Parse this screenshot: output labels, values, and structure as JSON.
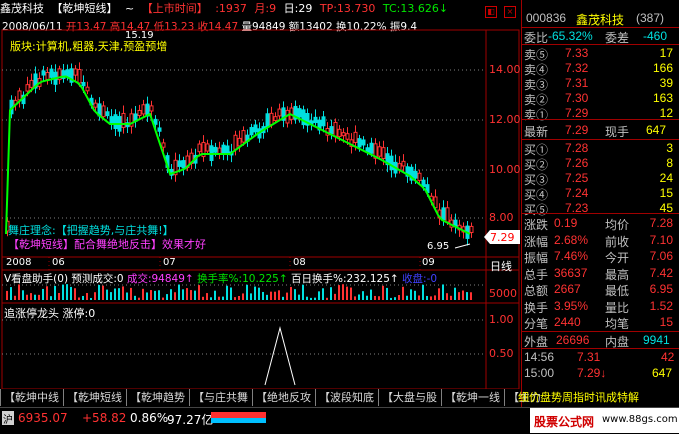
{
  "colors": {
    "up": "#ff3232",
    "down": "#00e0e0",
    "ma": "#00ff00",
    "frame": "#a00000",
    "label": "#ffff00",
    "peach": "#ffa0a0"
  },
  "header": {
    "stock_name": "鑫茂科技",
    "indicator": "【乾坤短线】",
    "tilde": "~",
    "ipo_time": "【上市时间】",
    "ipo_value": ":1937",
    "month": "月:9",
    "day": "日:29",
    "tp": "TP:13.730",
    "tc": "TC:13.626↓"
  },
  "quote_line": {
    "date": "2008/06/11",
    "open": "开13.47",
    "high": "高14.47",
    "low": "低13.23",
    "close": "收14.47",
    "volume": "量94849",
    "amount": "额13402",
    "turnover": "换10.22%",
    "amplitude": "振9.4"
  },
  "sector_label": "版块:计算机,粗器,天津,预盈预增",
  "high_marker": "15.19",
  "low_marker": "6.95",
  "price_axis": [
    "14.00",
    "12.00",
    "10.00",
    "8.00"
  ],
  "current_price_tag": "7.29",
  "philosophy": "舞庄理念:【把握趋势,与庄共舞!】",
  "combo_text": "【乾坤短线】配合舞绝地反击】效果才好",
  "date_axis": [
    "2008",
    "06",
    "07",
    "08",
    "09"
  ],
  "period_button": "日线",
  "volume_header": {
    "title": "V看盘助手(0) 预测成交:0",
    "vol": "成交:94849↑",
    "turnover": "换手率%:10.225↑",
    "hundred": "百日换手%:232.125↑",
    "close_label": "收盘:-0"
  },
  "vol_axis": "5000",
  "limit_up_title": "追涨停龙头 涨停:0",
  "limit_axis": [
    "1.00",
    "0.50"
  ],
  "right_panel": {
    "code": "000836",
    "name": "鑫茂科技",
    "suffix": "(387)",
    "wei_bi_label": "委比",
    "wei_bi": "-65.32%",
    "wei_cha_label": "委差",
    "wei_cha": "-460",
    "asks": [
      {
        "label": "卖⑤",
        "price": "7.33",
        "vol": "17"
      },
      {
        "label": "卖④",
        "price": "7.32",
        "vol": "166"
      },
      {
        "label": "卖③",
        "price": "7.31",
        "vol": "39"
      },
      {
        "label": "卖②",
        "price": "7.30",
        "vol": "163"
      },
      {
        "label": "卖①",
        "price": "7.29",
        "vol": "12"
      }
    ],
    "latest_label": "最新",
    "latest": "7.29",
    "now_vol_label": "现手",
    "now_vol": "647",
    "bids": [
      {
        "label": "买①",
        "price": "7.28",
        "vol": "3"
      },
      {
        "label": "买②",
        "price": "7.26",
        "vol": "8"
      },
      {
        "label": "买③",
        "price": "7.25",
        "vol": "24"
      },
      {
        "label": "买④",
        "price": "7.24",
        "vol": "15"
      },
      {
        "label": "买⑤",
        "price": "7.23",
        "vol": "45"
      }
    ],
    "stats": [
      {
        "l1": "涨跌",
        "v1": "0.19",
        "l2": "均价",
        "v2": "7.28"
      },
      {
        "l1": "涨幅",
        "v1": "2.68%",
        "l2": "前收",
        "v2": "7.10"
      },
      {
        "l1": "振幅",
        "v1": "7.46%",
        "l2": "今开",
        "v2": "7.06"
      },
      {
        "l1": "总手",
        "v1": "36637",
        "l2": "最高",
        "v2": "7.42"
      },
      {
        "l1": "总额",
        "v1": "2667",
        "l2": "最低",
        "v2": "6.95"
      },
      {
        "l1": "换手",
        "v1": "3.95%",
        "l2": "量比",
        "v2": "1.52"
      },
      {
        "l1": "分笔",
        "v1": "2440",
        "l2": "均笔",
        "v2": "15"
      }
    ],
    "outer_label": "外盘",
    "outer": "26696",
    "inner_label": "内盘",
    "inner": "9941",
    "ticks": [
      {
        "t": "14:56",
        "p": "7.31",
        "v": "42"
      },
      {
        "t": "15:00",
        "p": "7.29↓",
        "v": "647"
      }
    ]
  },
  "tabs": [
    "【乾坤中线",
    "【乾坤短线",
    "【乾坤趋势",
    "【与庄共舞",
    "【绝地反攻",
    "【波段知底",
    "【大盘与股",
    "【乾坤一线",
    "【主力"
  ],
  "overlay_text": "细价盘势周指时讯成特解",
  "status": {
    "index": "6935.07",
    "change": "+58.82",
    "pct": "0.86%",
    "amount": "97.27亿"
  },
  "watermark": {
    "main": "股票公式网",
    "url": "www.88gs.com"
  }
}
